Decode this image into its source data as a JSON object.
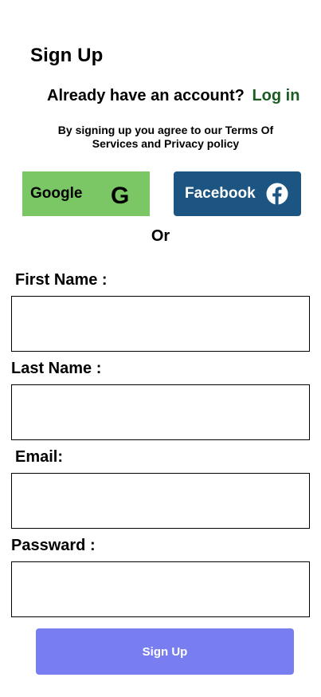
{
  "header": {
    "title": "Sign Up"
  },
  "login_prompt": {
    "text": "Already have an account?",
    "link": "Log in"
  },
  "terms": {
    "text": "By signing up you agree to our  Terms Of Services and Privacy policy"
  },
  "social": {
    "google_label": "Google",
    "google_icon": "google-g-icon",
    "facebook_label": "Facebook",
    "facebook_icon": "facebook-icon"
  },
  "divider": {
    "text": "Or"
  },
  "form": {
    "first_name_label": "First Name :",
    "first_name_value": "",
    "last_name_label": "Last Name :",
    "last_name_value": "",
    "email_label": "Email:",
    "email_value": "",
    "password_label": "Passward :",
    "password_value": "",
    "submit_label": "Sign Up"
  },
  "colors": {
    "google_bg": "#7bc765",
    "facebook_bg": "#1d5582",
    "login_link": "#1c5c22",
    "submit_bg": "#787def"
  }
}
